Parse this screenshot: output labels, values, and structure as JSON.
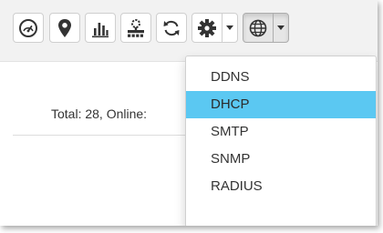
{
  "toolbar": {
    "buttons": [
      {
        "icon": "dashboard-gauge-icon"
      },
      {
        "icon": "location-pin-icon"
      },
      {
        "icon": "bar-chart-icon"
      },
      {
        "icon": "network-device-icon"
      },
      {
        "icon": "refresh-icon"
      },
      {
        "icon": "gear-icon",
        "dropdown": true
      },
      {
        "icon": "globe-icon",
        "dropdown": true,
        "active": true
      }
    ]
  },
  "summary": {
    "text": "Total: 28, Online:"
  },
  "network_menu": {
    "items": [
      {
        "label": "DDNS",
        "active": false
      },
      {
        "label": "DHCP",
        "active": true
      },
      {
        "label": "SMTP",
        "active": false
      },
      {
        "label": "SNMP",
        "active": false
      },
      {
        "label": "RADIUS",
        "active": false
      }
    ]
  },
  "colors": {
    "toolbar_bg": "#f2f2f2",
    "menu_highlight": "#5bc8f2",
    "icon": "#333333",
    "text": "#333333"
  }
}
